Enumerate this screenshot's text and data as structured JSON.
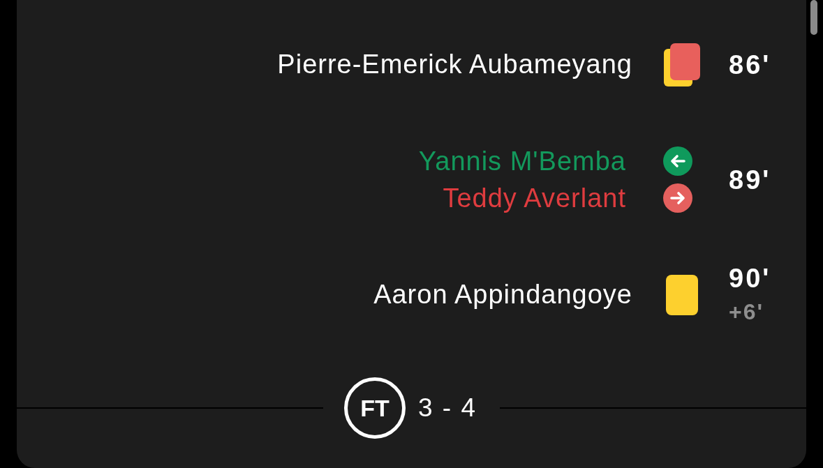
{
  "events": [
    {
      "kind": "second_yellow",
      "player": "Pierre-Emerick Aubameyang",
      "minute": "86'"
    },
    {
      "kind": "substitution",
      "player_in": "Yannis M'Bemba",
      "player_out": "Teddy Averlant",
      "minute": "89'"
    },
    {
      "kind": "yellow",
      "player": "Aaron Appindangoye",
      "minute": "90'",
      "added_time": "+6'"
    }
  ],
  "full_time": {
    "badge": "FT",
    "score": "3 - 4"
  }
}
